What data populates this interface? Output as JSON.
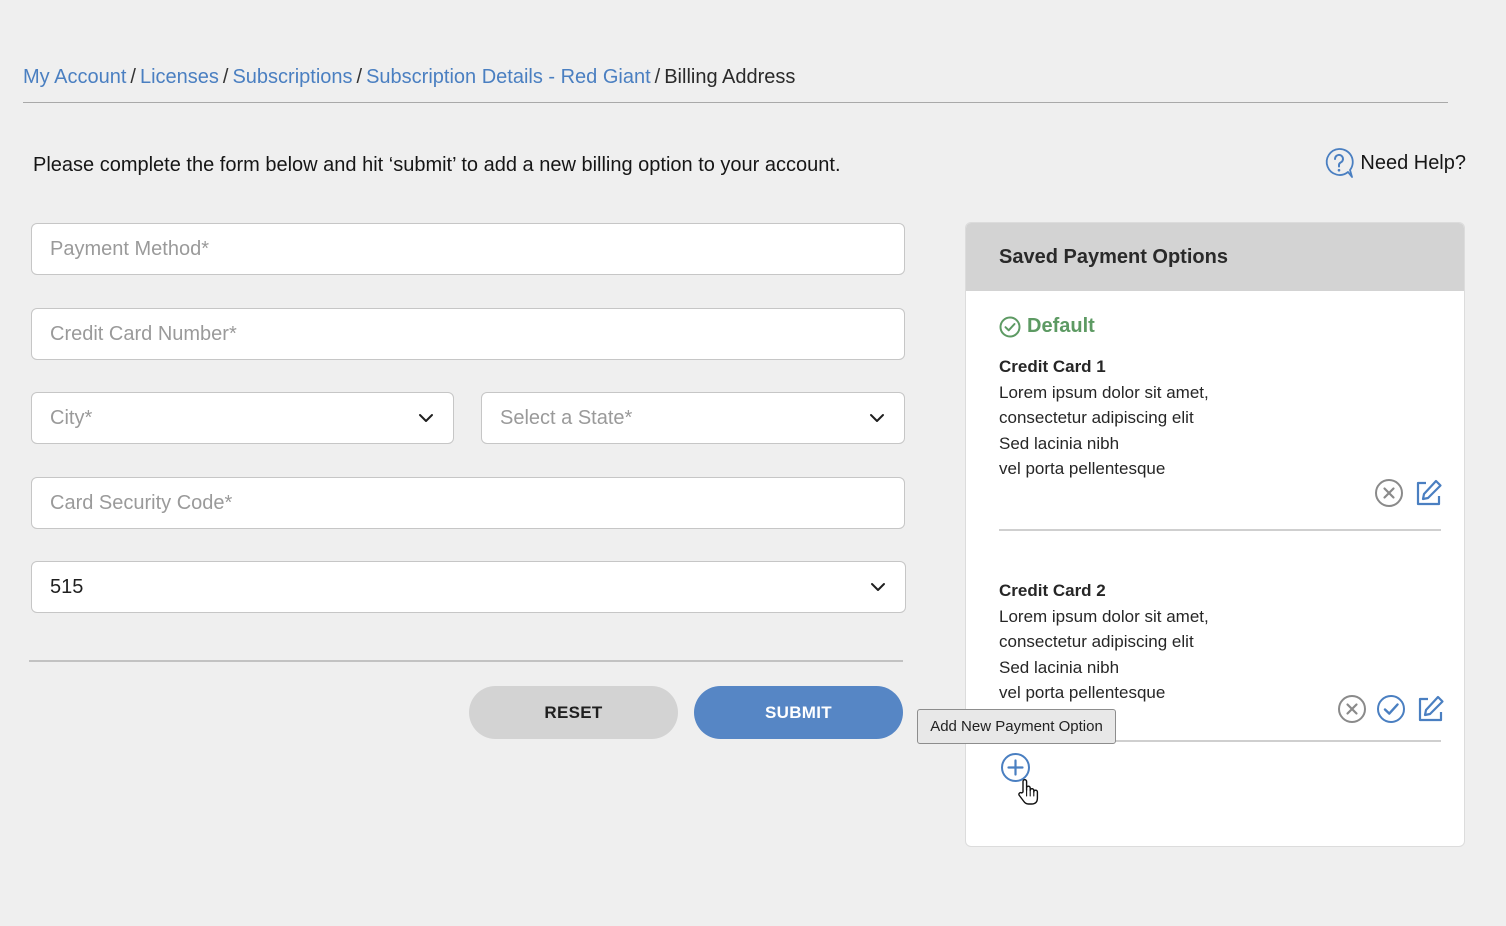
{
  "breadcrumb": {
    "items": [
      "My Account",
      "Licenses",
      "Subscriptions",
      "Subscription Details - Red Giant"
    ],
    "separator": "/",
    "current": "Billing Address"
  },
  "intro_text": "Please complete the form below and hit ‘submit’ to add a new billing option to your account.",
  "help": {
    "label": "Need Help?",
    "icon": "question-circle-icon"
  },
  "form": {
    "payment_method_placeholder": "Payment Method*",
    "card_number_placeholder": "Credit Card Number*",
    "city_placeholder": "City*",
    "state_placeholder": "Select a State*",
    "security_code_placeholder": "Card Security Code*",
    "area_code_value": "515"
  },
  "buttons": {
    "reset": "RESET",
    "submit": "SUBMIT"
  },
  "saved": {
    "title": "Saved Payment Options",
    "default_label": "Default",
    "cards": [
      {
        "title": "Credit Card 1",
        "lines": [
          "Lorem ipsum dolor sit amet,",
          "consectetur adipiscing elit",
          "Sed lacinia nibh",
          "vel porta pellentesque"
        ]
      },
      {
        "title": "Credit Card 2",
        "lines": [
          "Lorem ipsum dolor sit amet,",
          "consectetur adipiscing elit",
          "Sed lacinia nibh",
          "vel porta pellentesque"
        ]
      }
    ],
    "tooltip": "Add New Payment Option"
  },
  "colors": {
    "link": "#4a7fc1",
    "primary_button": "#5686c5",
    "default_green": "#5d9a63",
    "icon_gray": "#8a8a8a",
    "icon_blue": "#4a7fc1"
  }
}
